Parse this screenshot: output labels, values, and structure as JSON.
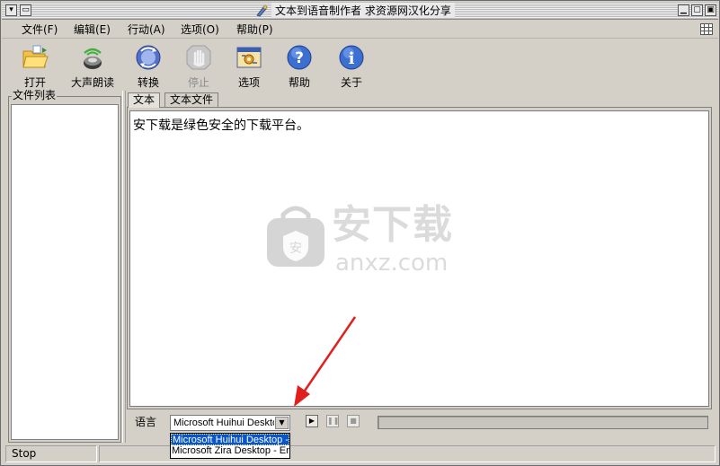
{
  "window": {
    "title": "文本到语音制作者 求资源网汉化分享"
  },
  "menu": {
    "items": [
      "文件(F)",
      "编辑(E)",
      "行动(A)",
      "选项(O)",
      "帮助(P)"
    ]
  },
  "toolbar": {
    "open": "打开",
    "read_aloud": "大声朗读",
    "convert": "转换",
    "stop": "停止",
    "options": "选项",
    "help": "帮助",
    "about": "关于"
  },
  "file_panel": {
    "label": "文件列表"
  },
  "tabs": {
    "text": "文本",
    "text_file": "文本文件"
  },
  "editor": {
    "content": "安下载是绿色安全的下载平台。"
  },
  "watermark": {
    "cn": "安下载",
    "en": "anxz.com",
    "badge": "安"
  },
  "voice": {
    "label": "语言",
    "selected": "Microsoft Huihui Desktop - Chinese",
    "options": [
      "Microsoft Huihui Desktop - Chinese",
      "Microsoft Zira Desktop - English"
    ]
  },
  "playback": {
    "progress": 0
  },
  "status": {
    "text": "Stop"
  },
  "colors": {
    "chrome": "#d4d0c8",
    "selection": "#0a55c8",
    "annotation_arrow": "#e01f1f"
  }
}
